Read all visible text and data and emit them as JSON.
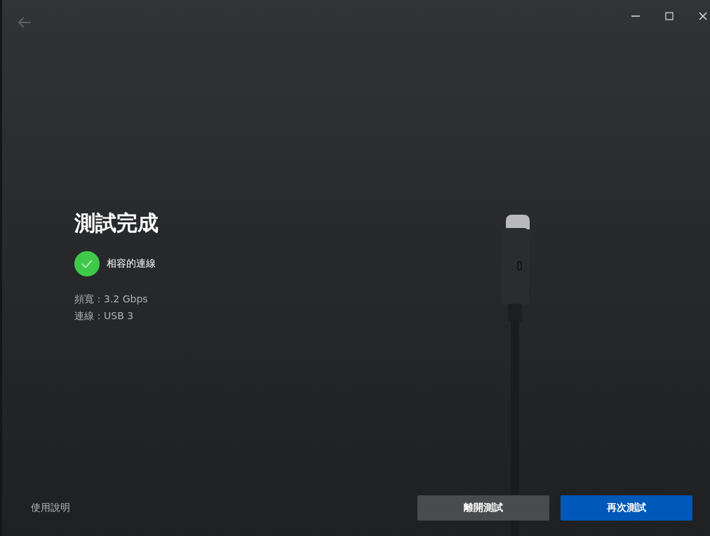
{
  "title": "測試完成",
  "result": {
    "compatible": true,
    "label": "相容的連線"
  },
  "details": [
    "頻寬：3.2 Gbps",
    "連線：USB 3"
  ],
  "footer": {
    "help_link": "使用說明",
    "buttons": [
      {
        "label": "離開測試",
        "kind": "secondary"
      },
      {
        "label": "再次測試",
        "kind": "primary"
      }
    ]
  }
}
